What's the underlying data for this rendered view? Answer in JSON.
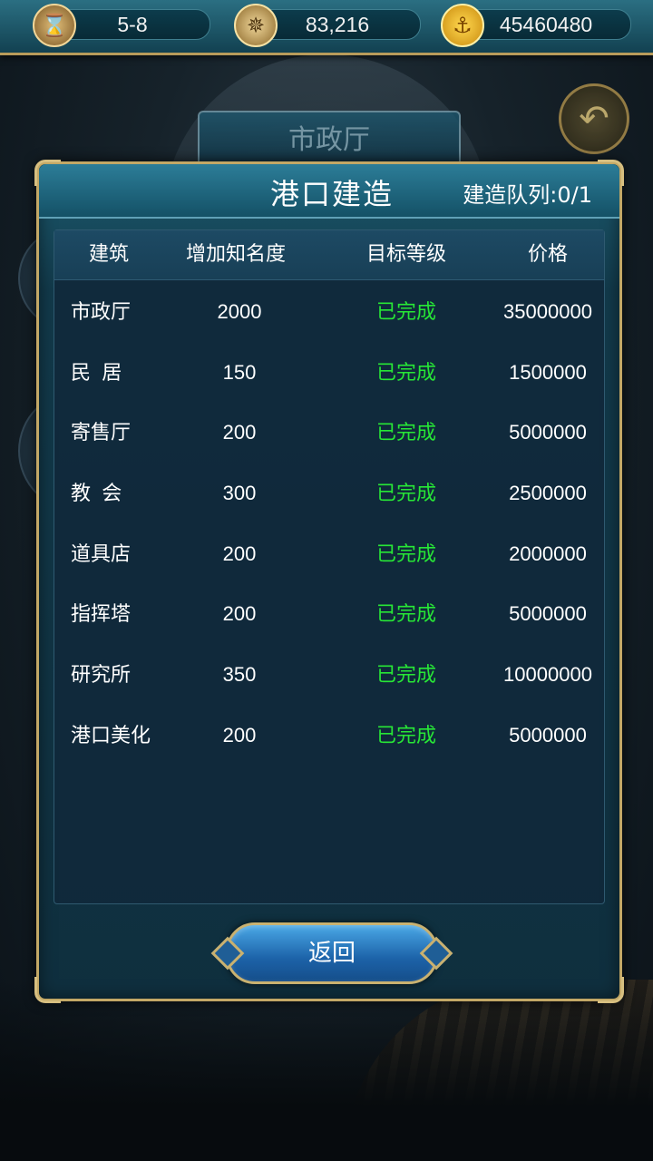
{
  "topbar": {
    "level": "5-8",
    "fame": "83,216",
    "gold": "45460480",
    "icons": [
      "hourglass-icon",
      "compass-icon",
      "anchor-icon"
    ]
  },
  "background": {
    "banner_title": "市政厅"
  },
  "dialog": {
    "title": "港口建造",
    "queue_label": "建造队列:0/1",
    "columns": [
      "建筑",
      "增加知名度",
      "目标等级",
      "价格"
    ],
    "rows": [
      {
        "name": "市政厅",
        "fame": "2000",
        "status": "已完成",
        "price": "35000000"
      },
      {
        "name": "民  居",
        "fame": "150",
        "status": "已完成",
        "price": "1500000"
      },
      {
        "name": "寄售厅",
        "fame": "200",
        "status": "已完成",
        "price": "5000000"
      },
      {
        "name": "教  会",
        "fame": "300",
        "status": "已完成",
        "price": "2500000"
      },
      {
        "name": "道具店",
        "fame": "200",
        "status": "已完成",
        "price": "2000000"
      },
      {
        "name": "指挥塔",
        "fame": "200",
        "status": "已完成",
        "price": "5000000"
      },
      {
        "name": "研究所",
        "fame": "350",
        "status": "已完成",
        "price": "10000000"
      },
      {
        "name": "港口美化",
        "fame": "200",
        "status": "已完成",
        "price": "5000000"
      }
    ],
    "return_label": "返回"
  },
  "colors": {
    "status_done": "#27e636",
    "frame_gold": "#c3a866",
    "header_teal": "#2c7d98"
  }
}
